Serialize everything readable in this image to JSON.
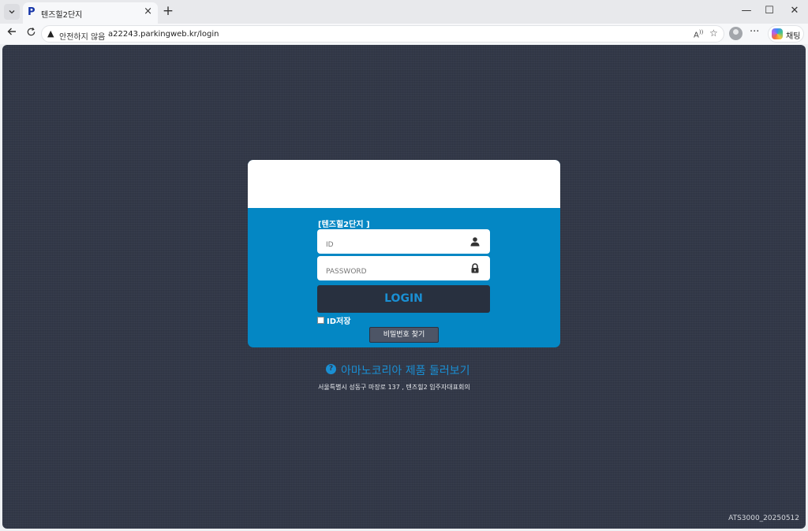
{
  "browser": {
    "tab": {
      "favicon": "P",
      "title": "텐즈힐2단지",
      "close": "×"
    },
    "new_tab": "+",
    "window": {
      "minimize": "—",
      "maximize": "☐",
      "close": "✕"
    },
    "address": {
      "security_label": "안전하지 않음",
      "url": "a22243.parkingweb.kr/login"
    },
    "copilot_label": "채팅",
    "more": "···"
  },
  "page": {
    "site_label": "[텐즈힐2단지 ]",
    "id_placeholder": "ID",
    "password_placeholder": "PASSWORD",
    "login_button": "LOGIN",
    "remember_label": "ID저장",
    "find_password_button": "비밀번호 찾기",
    "product_link": "아마노코리아 제품 둘러보기",
    "address": "서울특별시 성동구 마장로 137 , 텐즈힐2 입주자대표회의",
    "version": "ATS3000_20250512"
  },
  "colors": {
    "background": "#323848",
    "card_blue": "#0487c4",
    "login_button": "#28303f",
    "accent": "#1a8fd3"
  },
  "icons": [
    "tab-list-icon",
    "close-icon",
    "plus-icon",
    "back-arrow-icon",
    "reload-icon",
    "warning-icon",
    "read-aloud-icon",
    "favorite-star-icon",
    "profile-icon",
    "more-icon",
    "copilot-icon",
    "user-icon",
    "lock-icon",
    "question-icon"
  ]
}
